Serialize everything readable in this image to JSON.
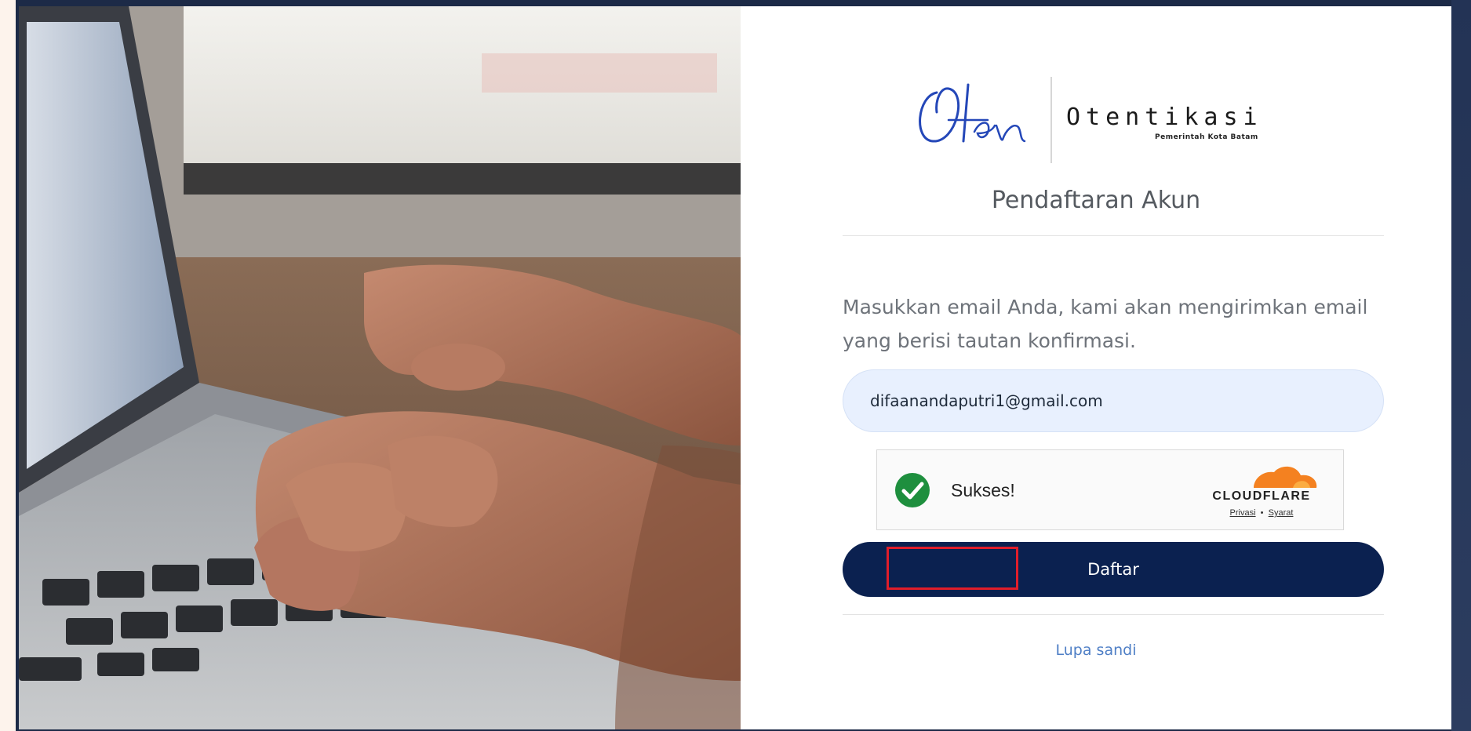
{
  "brand": {
    "script_mark": "OAen",
    "wordmark": "Otentikasi",
    "tagline": "Pemerintah Kota Batam"
  },
  "page": {
    "title": "Pendaftaran Akun",
    "instructions": "Masukkan email Anda, kami akan mengirimkan email yang berisi tautan konfirmasi."
  },
  "form": {
    "email_value": "difaanandaputri1@gmail.com",
    "submit_label": "Daftar",
    "forgot_label": "Lupa sandi"
  },
  "captcha": {
    "status": "Sukses!",
    "provider": "CLOUDFLARE",
    "privacy_label": "Privasi",
    "separator": "•",
    "terms_label": "Syarat"
  },
  "colors": {
    "button_bg": "#0b2150",
    "input_bg": "#e8f0fe",
    "link": "#4f7fc6",
    "success": "#1e8f3e",
    "highlight": "#e11d2a",
    "cloudflare_orange": "#f48120"
  },
  "icons": {
    "captcha_check": "check-circle-icon",
    "provider_logo": "cloudflare-cloud-icon"
  }
}
